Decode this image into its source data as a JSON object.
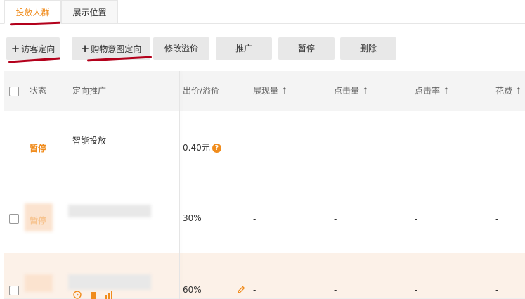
{
  "tabs": [
    {
      "label": "投放人群",
      "active": true
    },
    {
      "label": "展示位置",
      "active": false
    }
  ],
  "toolbar": {
    "visitor_label": "访客定向",
    "intent_label": "购物意图定向",
    "modify_label": "修改溢价",
    "promote_label": "推广",
    "pause_label": "暂停",
    "delete_label": "删除",
    "plus_glyph": "+"
  },
  "table": {
    "headers": {
      "status": "状态",
      "target": "定向推广",
      "bid": "出价/溢价",
      "impressions": "展现量 ↑",
      "clicks": "点击量 ↑",
      "ctr": "点击率 ↑",
      "cost": "花费 ↑"
    },
    "rows": [
      {
        "status": "暂停",
        "target": "智能投放",
        "bid": "0.40元",
        "impressions": "-",
        "clicks": "-",
        "ctr": "-",
        "cost": "-"
      },
      {
        "status": "暂停",
        "target": "",
        "bid": "30%",
        "impressions": "-",
        "clicks": "-",
        "ctr": "-",
        "cost": "-"
      },
      {
        "status": "",
        "target": "",
        "bid": "60%",
        "impressions": "-",
        "clicks": "-",
        "ctr": "-",
        "cost": "-"
      }
    ],
    "help_glyph": "?"
  },
  "colors": {
    "accent": "#f08c1d",
    "marker": "#b3001b",
    "highlight_row": "#fcf1e8"
  },
  "icons": [
    "plus-icon",
    "help-icon",
    "edit-pencil-icon",
    "play-icon",
    "trash-icon",
    "chart-icon"
  ]
}
